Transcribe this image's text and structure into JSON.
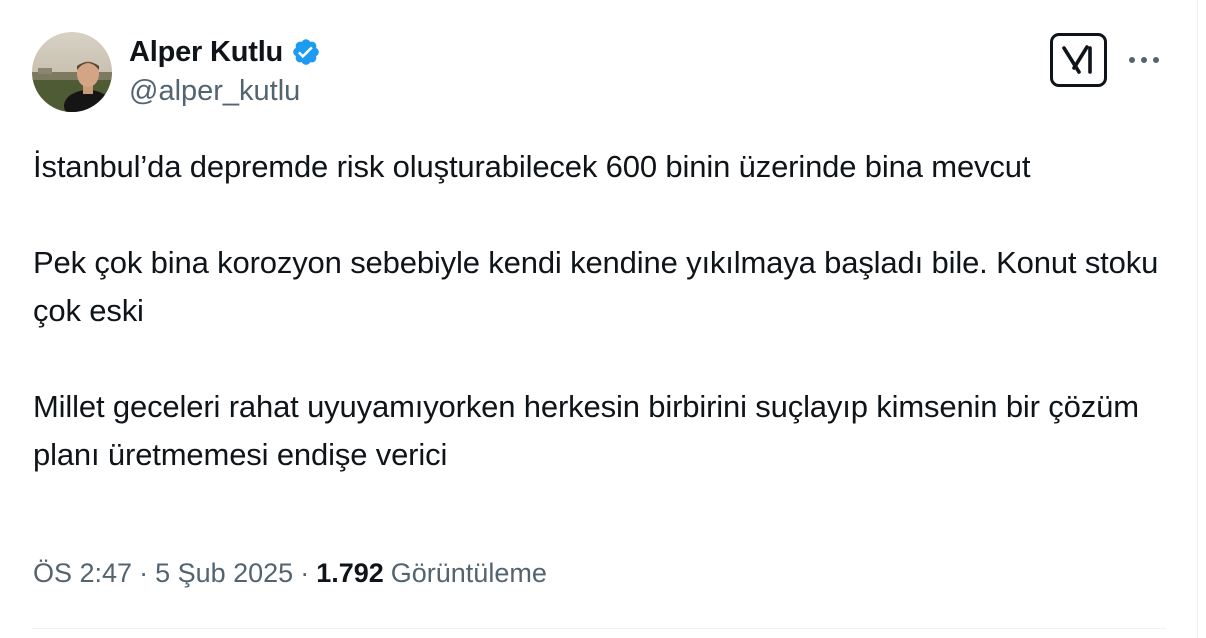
{
  "author": {
    "display_name": "Alper Kutlu",
    "handle": "@alper_kutlu",
    "verified": true,
    "avatar_icon": "profile-photo"
  },
  "toolbar": {
    "grok_icon": "grok-icon",
    "more_icon": "more-horizontal-icon"
  },
  "tweet": {
    "paragraphs": [
      "İstanbul’da depremde risk oluşturabilecek 600 binin üzerinde bina mevcut",
      "Pek çok bina korozyon sebebiyle kendi kendine yıkılmaya başladı bile. Konut stoku çok eski",
      "Millet geceleri rahat uyuyamıyorken herkesin birbirini suçlayıp kimsenin bir çözüm planı üretmemesi endişe verici"
    ]
  },
  "meta": {
    "time": "ÖS 2:47",
    "separator": "·",
    "date": "5 Şub 2025",
    "views_count": "1.792",
    "views_label": "Görüntüleme"
  },
  "colors": {
    "text_primary": "#0f1419",
    "text_secondary": "#536471",
    "verified_blue": "#1d9bf0",
    "divider": "#eff3f4"
  }
}
